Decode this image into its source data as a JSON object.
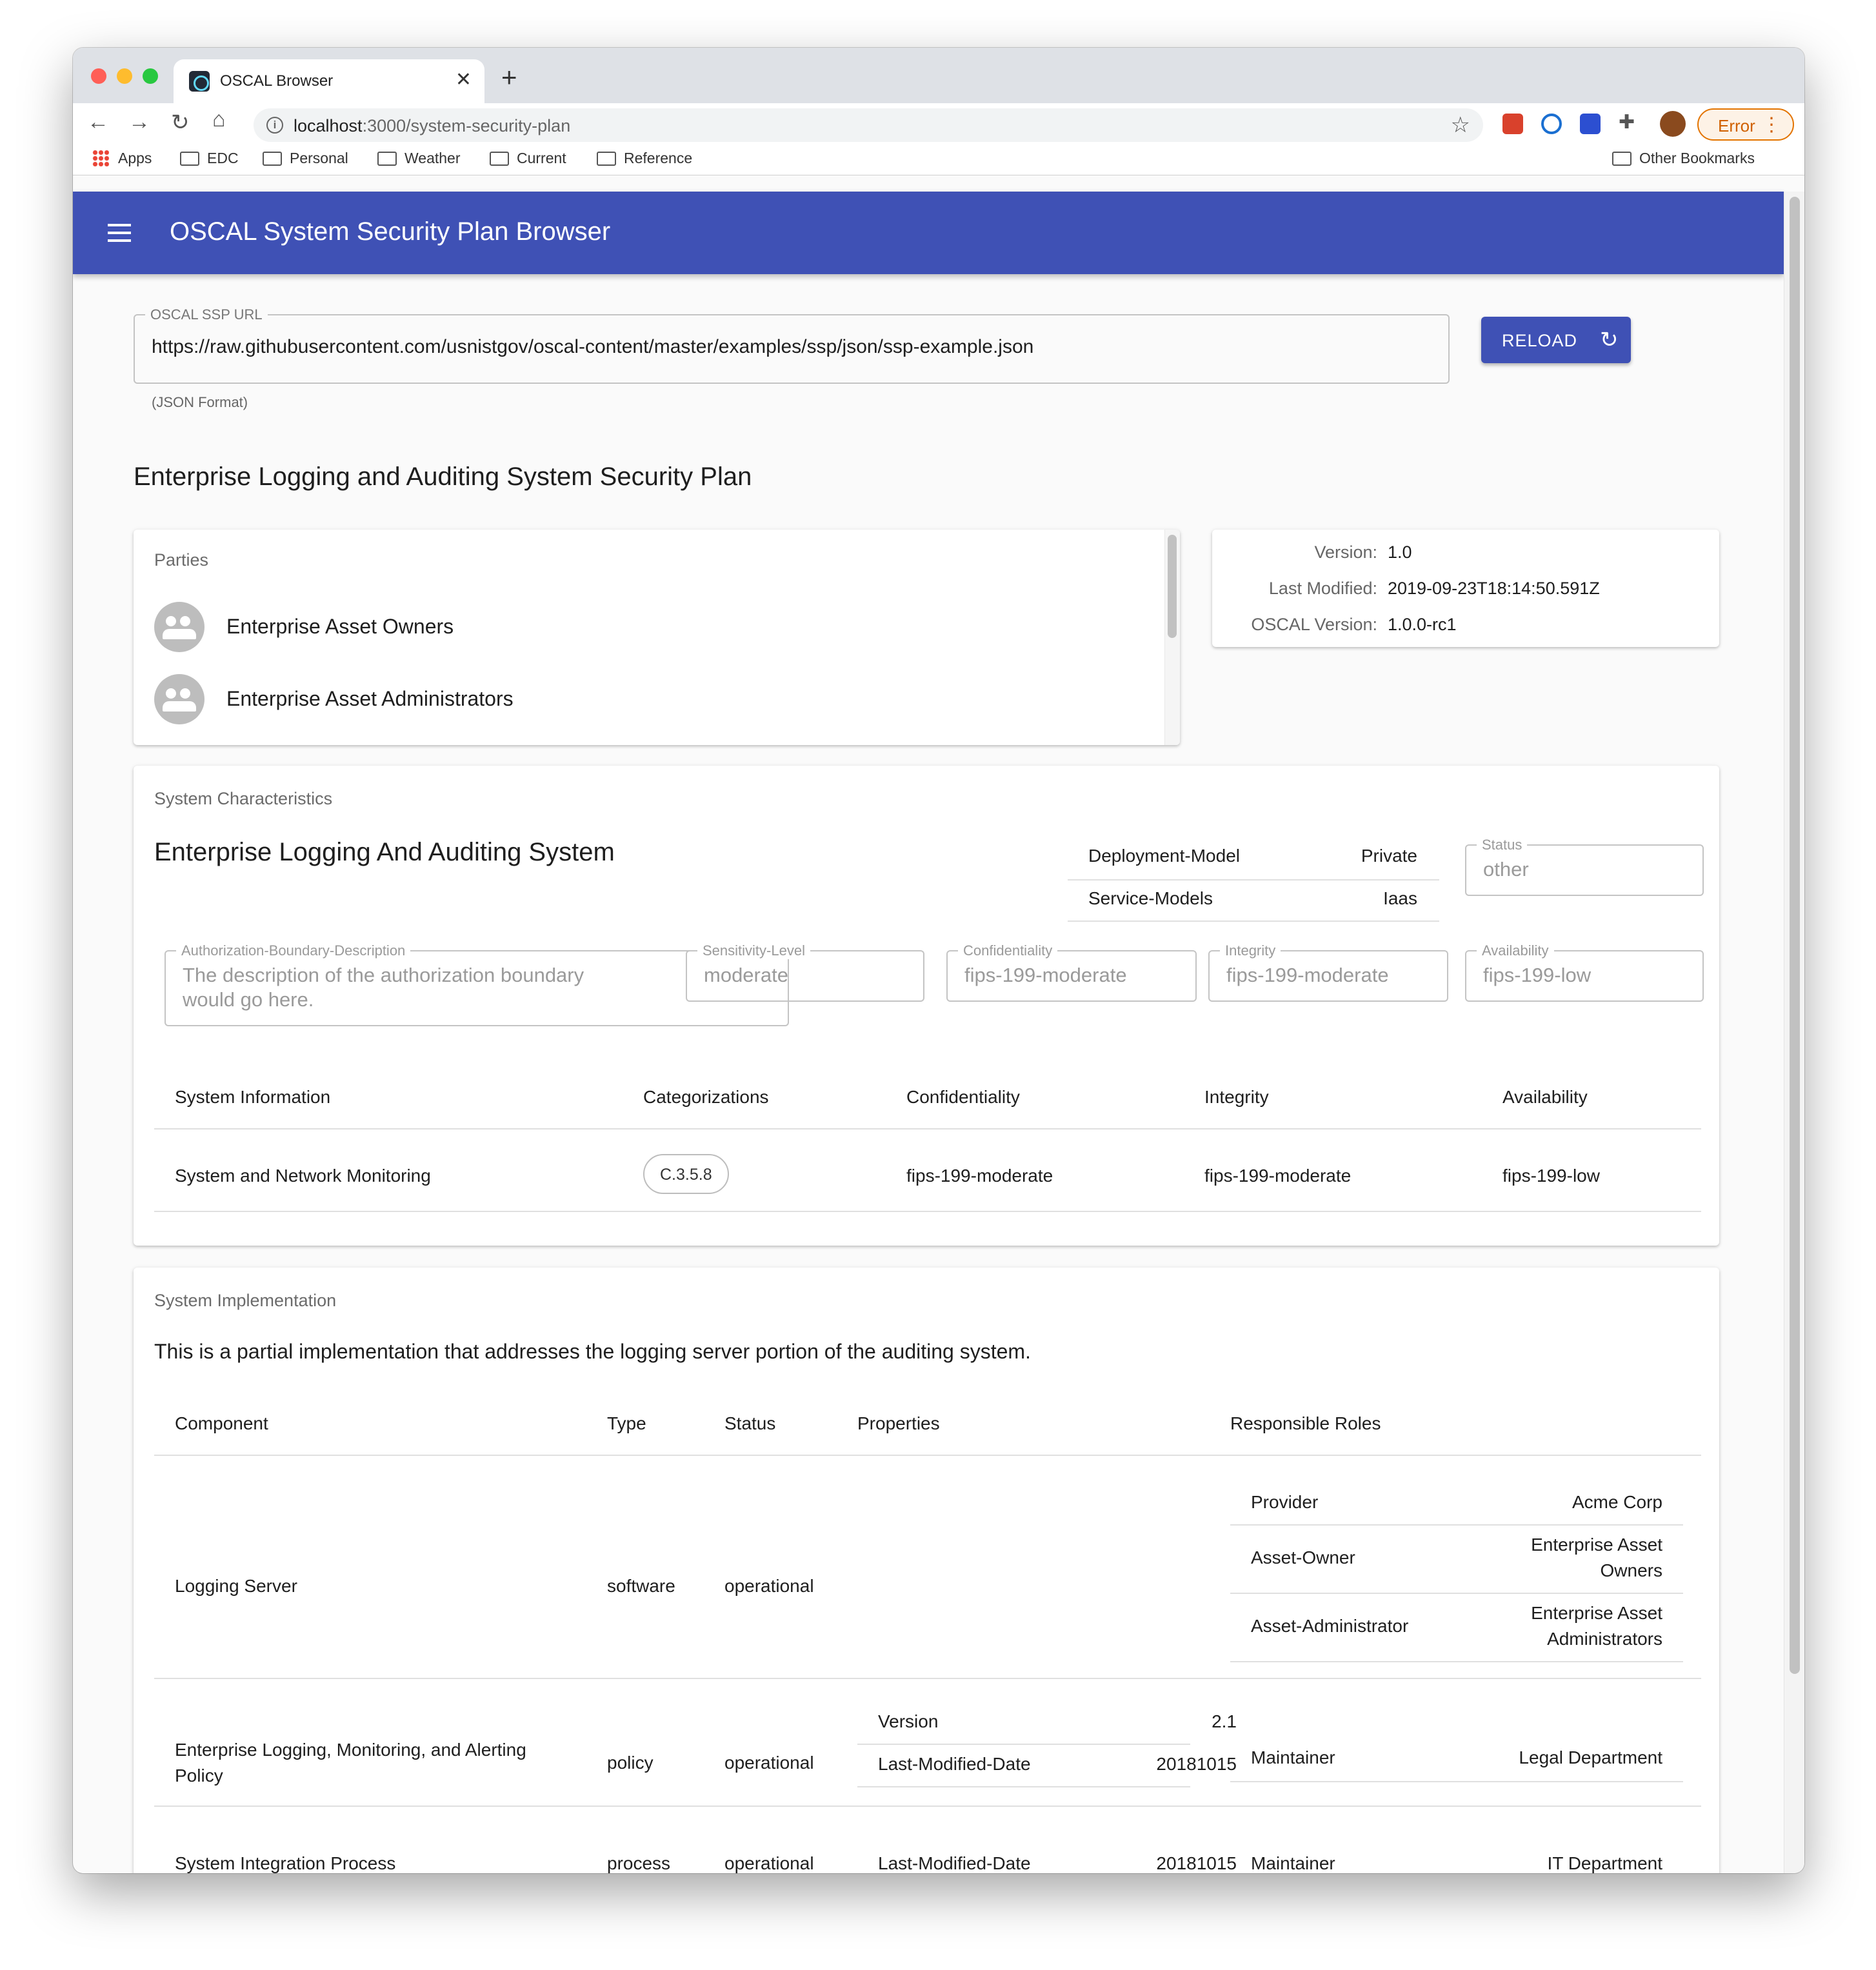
{
  "browser": {
    "tab_title": "OSCAL Browser",
    "tab_close": "✕",
    "new_tab": "+",
    "url_host": "localhost",
    "url_path": ":3000/system-security-plan",
    "error_label": "Error",
    "bookmarks": [
      "Apps",
      "EDC",
      "Personal",
      "Weather",
      "Current",
      "Reference"
    ],
    "other_bookmarks": "Other Bookmarks",
    "icons": [
      "back-icon",
      "forward-icon",
      "reload-icon",
      "home-icon",
      "info-icon",
      "star-icon",
      "extension-icon"
    ]
  },
  "app": {
    "title": "OSCAL System Security Plan Browser"
  },
  "url_field": {
    "legend": "OSCAL SSP URL",
    "value": "https://raw.githubusercontent.com/usnistgov/oscal-content/master/examples/ssp/json/ssp-example.json",
    "helper": "(JSON Format)",
    "reload_label": "RELOAD"
  },
  "ssp_title": "Enterprise Logging and Auditing System Security Plan",
  "parties": {
    "label": "Parties",
    "items": [
      "Enterprise Asset Owners",
      "Enterprise Asset Administrators"
    ]
  },
  "metadata": {
    "version_label": "Version:",
    "version": "1.0",
    "last_modified_label": "Last Modified:",
    "last_modified": "2019-09-23T18:14:50.591Z",
    "oscal_version_label": "OSCAL Version:",
    "oscal_version": "1.0.0-rc1"
  },
  "system_characteristics": {
    "label": "System Characteristics",
    "system_name": "Enterprise Logging And Auditing System",
    "properties": [
      {
        "name": "Deployment-Model",
        "value": "Private"
      },
      {
        "name": "Service-Models",
        "value": "Iaas"
      }
    ],
    "status_legend": "Status",
    "status_value": "other",
    "auth_boundary_legend": "Authorization-Boundary-Description",
    "auth_boundary_line1": "The description of the authorization boundary",
    "auth_boundary_line2": "would go here.",
    "sensitivity_legend": "Sensitivity-Level",
    "sensitivity_value": "moderate",
    "confidentiality_legend": "Confidentiality",
    "confidentiality_value": "fips-199-moderate",
    "integrity_legend": "Integrity",
    "integrity_value": "fips-199-moderate",
    "availability_legend": "Availability",
    "availability_value": "fips-199-low",
    "info_table": {
      "headers": [
        "System Information",
        "Categorizations",
        "Confidentiality",
        "Integrity",
        "Availability"
      ],
      "row": {
        "system_information": "System and Network Monitoring",
        "categorization": "C.3.5.8",
        "confidentiality": "fips-199-moderate",
        "integrity": "fips-199-moderate",
        "availability": "fips-199-low"
      }
    }
  },
  "system_implementation": {
    "label": "System Implementation",
    "description": "This is a partial implementation that addresses the logging server portion of the auditing system.",
    "headers": [
      "Component",
      "Type",
      "Status",
      "Properties",
      "Responsible Roles"
    ],
    "rows": [
      {
        "component": "Logging Server",
        "type": "software",
        "status": "operational",
        "roles": [
          {
            "role": "Provider",
            "party": "Acme Corp"
          },
          {
            "role": "Asset-Owner",
            "party_line1": "Enterprise Asset",
            "party_line2": "Owners"
          },
          {
            "role": "Asset-Administrator",
            "party_line1": "Enterprise Asset",
            "party_line2": "Administrators"
          }
        ]
      },
      {
        "component_line1": "Enterprise Logging, Monitoring, and Alerting",
        "component_line2": "Policy",
        "type": "policy",
        "status": "operational",
        "properties": [
          {
            "name": "Version",
            "value": "2.1"
          },
          {
            "name": "Last-Modified-Date",
            "value": "20181015"
          }
        ],
        "roles": [
          {
            "role": "Maintainer",
            "party": "Legal Department"
          }
        ]
      },
      {
        "component": "System Integration Process",
        "type": "process",
        "status": "operational",
        "properties": [
          {
            "name": "Last-Modified-Date",
            "value": "20181015"
          }
        ],
        "roles": [
          {
            "role": "Maintainer",
            "party": "IT Department"
          }
        ]
      }
    ]
  },
  "colors": {
    "primary": "#3f51b5",
    "error_accent": "#e37400"
  }
}
